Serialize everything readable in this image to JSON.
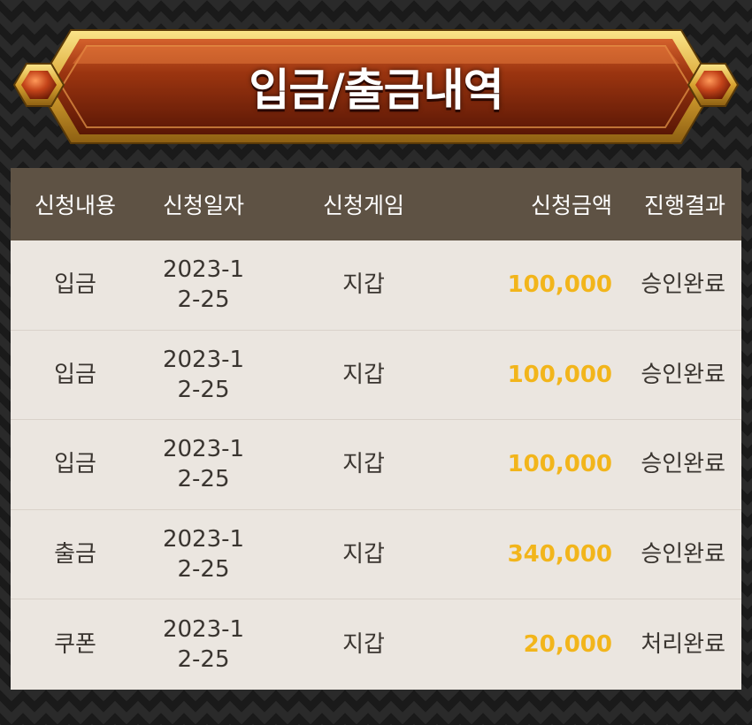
{
  "banner": {
    "title": "입금/출금내역"
  },
  "table": {
    "headers": [
      "신청내용",
      "신청일자",
      "신청게임",
      "신청금액",
      "진행결과"
    ],
    "rows": [
      {
        "type": "입금",
        "date": "2023-12-25",
        "game": "지갑",
        "amount": "100,000",
        "result": "승인완료"
      },
      {
        "type": "입금",
        "date": "2023-12-25",
        "game": "지갑",
        "amount": "100,000",
        "result": "승인완료"
      },
      {
        "type": "입금",
        "date": "2023-12-25",
        "game": "지갑",
        "amount": "100,000",
        "result": "승인완료"
      },
      {
        "type": "출금",
        "date": "2023-12-25",
        "game": "지갑",
        "amount": "340,000",
        "result": "승인완료"
      },
      {
        "type": "쿠폰",
        "date": "2023-12-25",
        "game": "지갑",
        "amount": "20,000",
        "result": "처리완료"
      }
    ]
  },
  "colors": {
    "header_bg": "#5e5244",
    "row_bg": "#ebe6e0",
    "amount": "#f2b51b",
    "banner_red": "#8a2a0a",
    "banner_gold": "#e0b53a"
  },
  "icons": {
    "left_gem": "hexagon-gem-icon",
    "right_gem": "hexagon-gem-icon"
  }
}
